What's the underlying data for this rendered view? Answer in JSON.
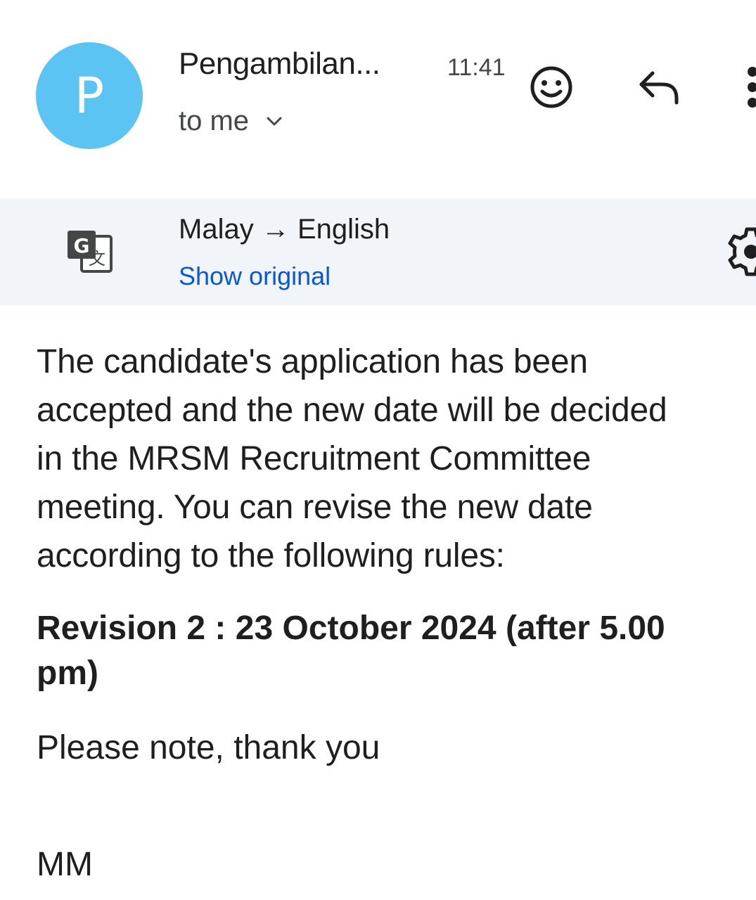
{
  "header": {
    "avatar_letter": "P",
    "avatar_color": "#5bc4f3",
    "sender": "Pengambilan...",
    "time": "11:41",
    "recipient": "to me",
    "icons": [
      "add-emoji-icon",
      "reply-icon",
      "more-vert-icon",
      "chevron-down-icon"
    ]
  },
  "translate": {
    "source_language": "Malay",
    "arrow": "→",
    "target_language": "English",
    "show_original": "Show original",
    "icons": [
      "google-translate-icon",
      "gear-icon"
    ]
  },
  "message": {
    "paragraph_lines": [
      "The candidate's application has been",
      "accepted and the new date will be decided",
      "in the MRSM Recruitment Committee",
      "meeting. You can revise the new date",
      "according to the following rules:"
    ],
    "revision_lines": [
      "Revision 2 : 23 October 2024 (after 5.00",
      "pm)"
    ],
    "closing": "Please note, thank you",
    "signature": "MM"
  },
  "colors": {
    "link": "#0b57d0",
    "translate_bar_bg": "#f1f4f9",
    "text": "#1f1f1f"
  }
}
